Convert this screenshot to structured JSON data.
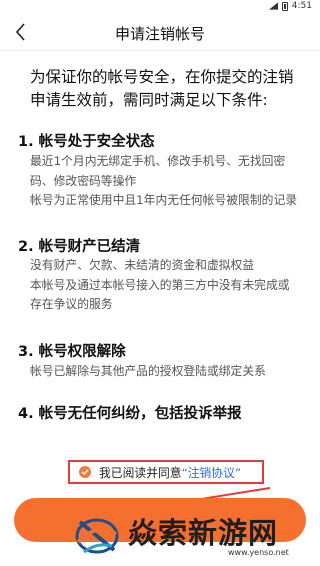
{
  "status_bar": {
    "time": "4:51"
  },
  "header": {
    "title": "申请注销帐号"
  },
  "intro": "为保证你的帐号安全，在你提交的注销申请生效前，需同时满足以下条件:",
  "sections": [
    {
      "title": "1. 帐号处于安全状态",
      "lines": [
        "最近1个月内无绑定手机、修改手机号、无找回密",
        "码、修改密码等操作",
        "帐号为正常使用中且1年内无任何帐号被限制的记录"
      ]
    },
    {
      "title": "2. 帐号财产已结清",
      "lines": [
        "没有财产、欠款、未结清的资金和虚拟权益",
        "本帐号及通过本帐号接入的第三方中没有未完成或",
        "存在争议的服务"
      ]
    },
    {
      "title": "3. 帐号权限解除",
      "lines": [
        "帐号已解除与其他产品的授权登陆或绑定关系"
      ]
    },
    {
      "title": "4. 帐号无任何纠纷，包括投诉举报",
      "lines": []
    }
  ],
  "agreement": {
    "prefix": "我已阅读并同意",
    "link": "“注销协议”"
  },
  "watermark": {
    "text": "焱索新游网",
    "url": "www.yenso.net"
  },
  "colors": {
    "accent": "#f5702e",
    "link": "#2e6fd6",
    "highlight": "#e23b3b"
  }
}
